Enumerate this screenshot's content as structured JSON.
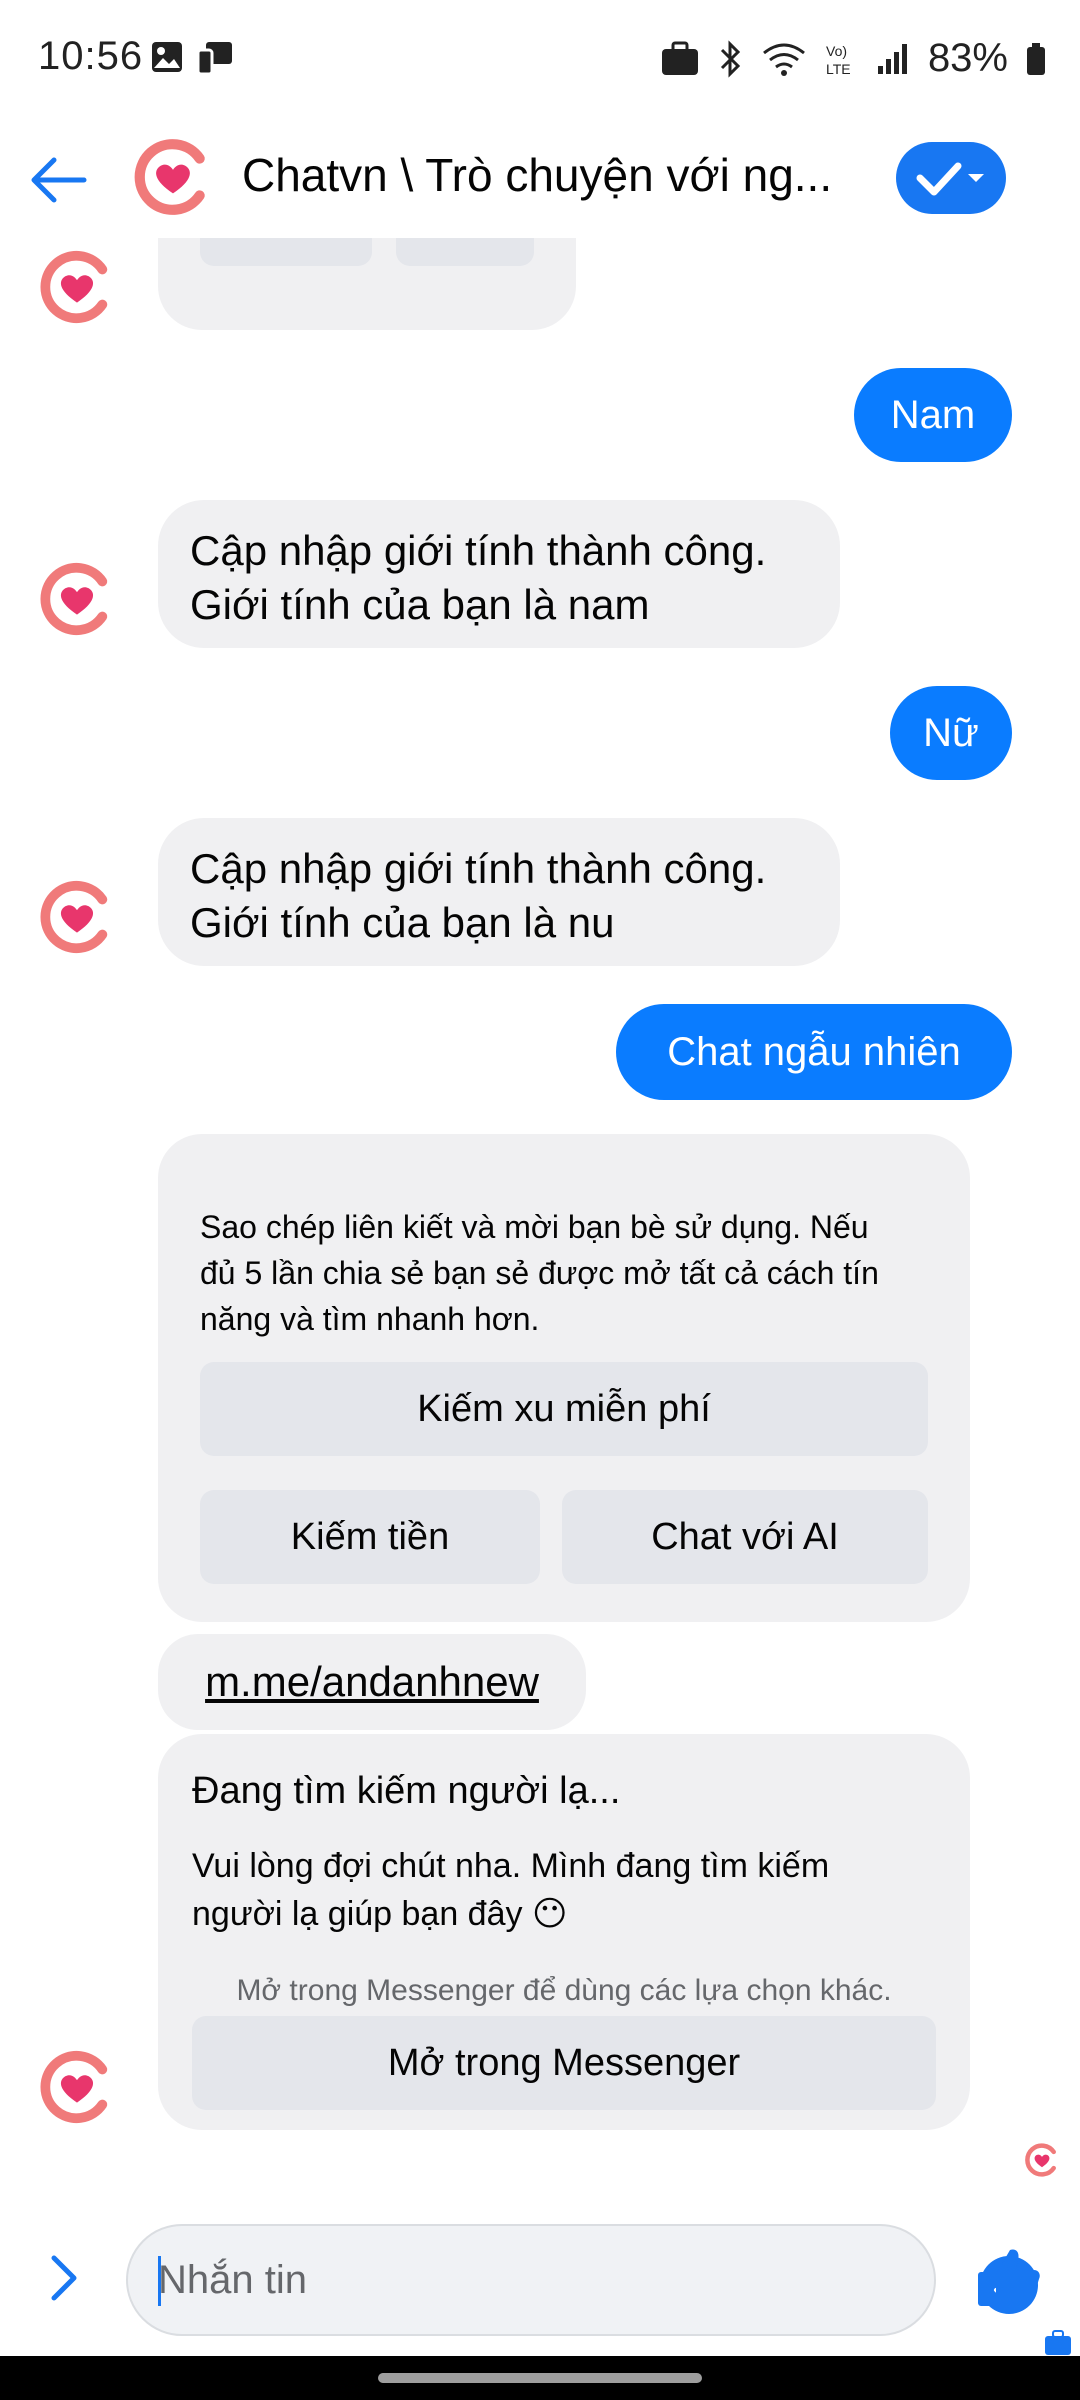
{
  "status_bar": {
    "time": "10:56",
    "battery": "83%",
    "icons": [
      "image-icon",
      "device-icon",
      "briefcase-icon",
      "bluetooth-icon",
      "wifi-icon",
      "volte-icon",
      "signal-icon",
      "battery-icon"
    ]
  },
  "header": {
    "title": "Chatvn \\ Trò chuyện với ng..."
  },
  "messages": {
    "m1": "Nam",
    "m2_line1": "Cập nhập giới tính thành công.",
    "m2_line2": "Giới tính của bạn là nam",
    "m3": "Nữ",
    "m4_line1": "Cập nhập giới tính thành công.",
    "m4_line2": "Giới tính của bạn là nu",
    "m5": "Chat ngẫu nhiên"
  },
  "invite_card": {
    "text": "Sao chép liên kiết và mời bạn bè sử dụng. Nếu đủ 5 lần chia sẻ bạn sẻ được mở tất cả cách tín năng và tìm nhanh hơn.",
    "btn_free": "Kiếm xu miễn phí",
    "btn_earn": "Kiếm tiền",
    "btn_ai": "Chat với AI"
  },
  "link_bubble": "m.me/andanhnew",
  "search_card": {
    "title": "Đang tìm kiếm người lạ...",
    "body": "Vui lòng đợi chút nha. Mình đang tìm kiếm người lạ giúp bạn đây 😶",
    "hint": "Mở trong Messenger để dùng các lựa chọn khác.",
    "btn_open": "Mở trong Messenger"
  },
  "composer": {
    "placeholder": "Nhắn tin"
  },
  "colors": {
    "accent": "#0a7cff",
    "bubble_in": "#f0f0f2",
    "button": "#e4e6eb",
    "avatar_ring": "#f07a7a",
    "avatar_heart": "#e8366c"
  }
}
